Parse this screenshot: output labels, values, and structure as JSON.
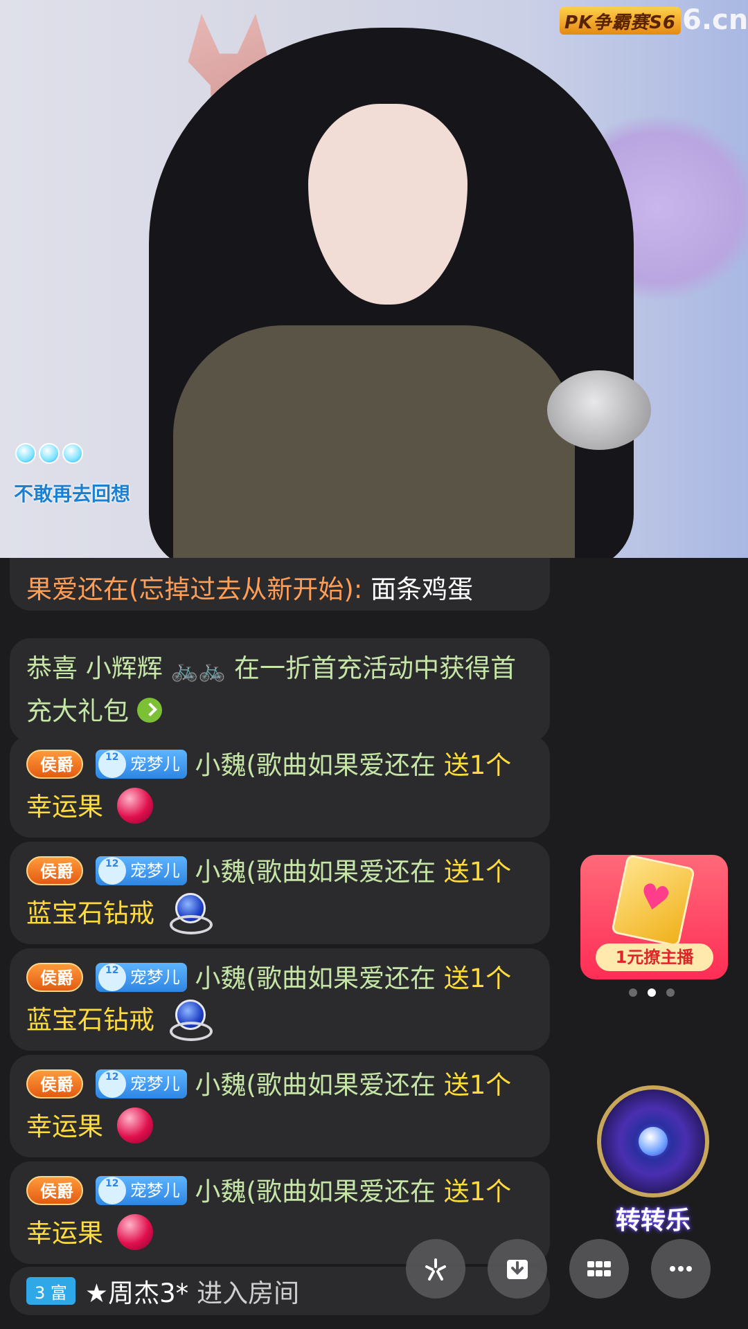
{
  "video": {
    "brand_badge": "PK争霸赛S6",
    "brand_site": "6.cn",
    "song_caption": "不敢再去回想"
  },
  "chat": {
    "partial_message": {
      "sender": "果爱还在(忘掉过去从新开始):",
      "text": "面条鸡蛋"
    },
    "system_message": {
      "prefix": "恭喜 小辉辉",
      "suffix": "在一折首充活动中获得首充大礼包"
    },
    "gift_messages": [
      {
        "rank": "侯爵",
        "fan_level": "12",
        "fan_club": "宠梦儿",
        "sender": "小魏(歌曲如果爱还在",
        "action": "送1个",
        "gift": "幸运果",
        "gift_icon": "apple-gift-icon"
      },
      {
        "rank": "侯爵",
        "fan_level": "12",
        "fan_club": "宠梦儿",
        "sender": "小魏(歌曲如果爱还在",
        "action": "送1个",
        "gift": "蓝宝石钻戒",
        "gift_icon": "sapphire-ring-gift-icon"
      },
      {
        "rank": "侯爵",
        "fan_level": "12",
        "fan_club": "宠梦儿",
        "sender": "小魏(歌曲如果爱还在",
        "action": "送1个",
        "gift": "蓝宝石钻戒",
        "gift_icon": "sapphire-ring-gift-icon"
      },
      {
        "rank": "侯爵",
        "fan_level": "12",
        "fan_club": "宠梦儿",
        "sender": "小魏(歌曲如果爱还在",
        "action": "送1个",
        "gift": "幸运果",
        "gift_icon": "apple-gift-icon"
      },
      {
        "rank": "侯爵",
        "fan_level": "12",
        "fan_club": "宠梦儿",
        "sender": "小魏(歌曲如果爱还在",
        "action": "送1个",
        "gift": "幸运果",
        "gift_icon": "apple-gift-icon"
      }
    ],
    "enter_message": {
      "wealth_badge": "3 富",
      "user": "★周杰3*",
      "text": "进入房间"
    }
  },
  "promos": {
    "card_label": "1元撩主播",
    "carousel_active_index": 1,
    "carousel_count": 3,
    "wheel_label": "转转乐"
  },
  "toolbar": {
    "buttons": [
      "share-icon",
      "download-icon",
      "apps-grid-icon",
      "more-icon"
    ]
  },
  "colors": {
    "background": "#1c1c1e",
    "bubble": "#2b2b2d",
    "sender_orange": "#ff9e57",
    "sender_green": "#c5e6a6",
    "gift_yellow": "#ffdc3c"
  }
}
